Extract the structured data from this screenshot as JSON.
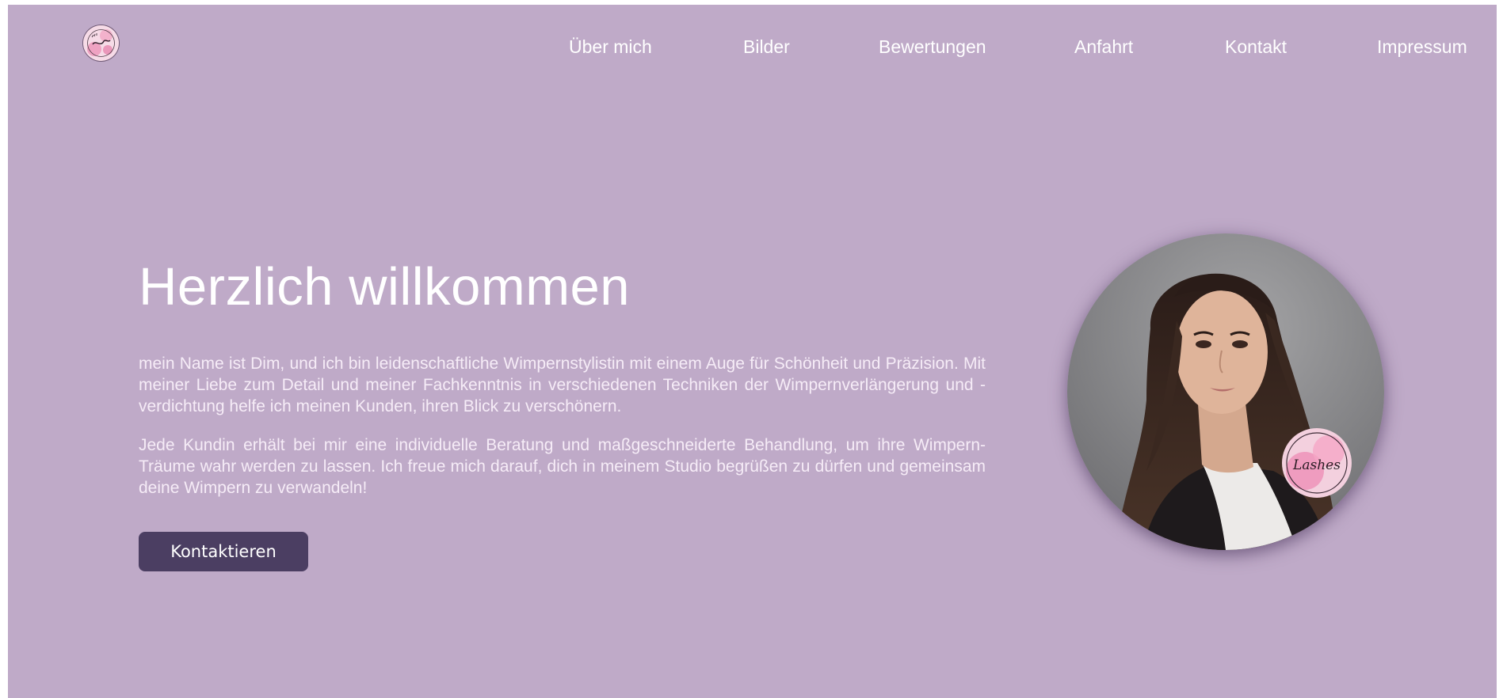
{
  "header": {
    "logo_icon": "lashes-logo-icon",
    "nav": [
      {
        "label": "Über mich"
      },
      {
        "label": "Bilder"
      },
      {
        "label": "Bewertungen"
      },
      {
        "label": "Anfahrt"
      },
      {
        "label": "Kontakt"
      },
      {
        "label": "Impressum"
      }
    ]
  },
  "hero": {
    "title": "Herzlich willkommen",
    "paragraphs": [
      "mein Name ist Dim, und ich bin leidenschaftliche Wimpernstylistin mit einem Auge für Schönheit und Präzision. Mit meiner Liebe zum Detail und meiner Fachkenntnis in verschiedenen Techniken der Wimpernverlängerung und -verdichtung helfe ich meinen Kunden, ihren Blick zu verschönern.",
      "Jede Kundin erhält bei mir eine individuelle Beratung und maßgeschneiderte Behandlung, um ihre Wimpern-Träume wahr werden zu lassen. Ich freue mich darauf, dich in meinem Studio begrüßen zu dürfen und gemeinsam deine Wimpern zu verwandeln!"
    ],
    "cta_label": "Kontaktieren",
    "portrait_badge_text": "Lashes"
  },
  "colors": {
    "background": "#bfaac8",
    "button": "#4b3e62",
    "text": "#ffffff"
  }
}
